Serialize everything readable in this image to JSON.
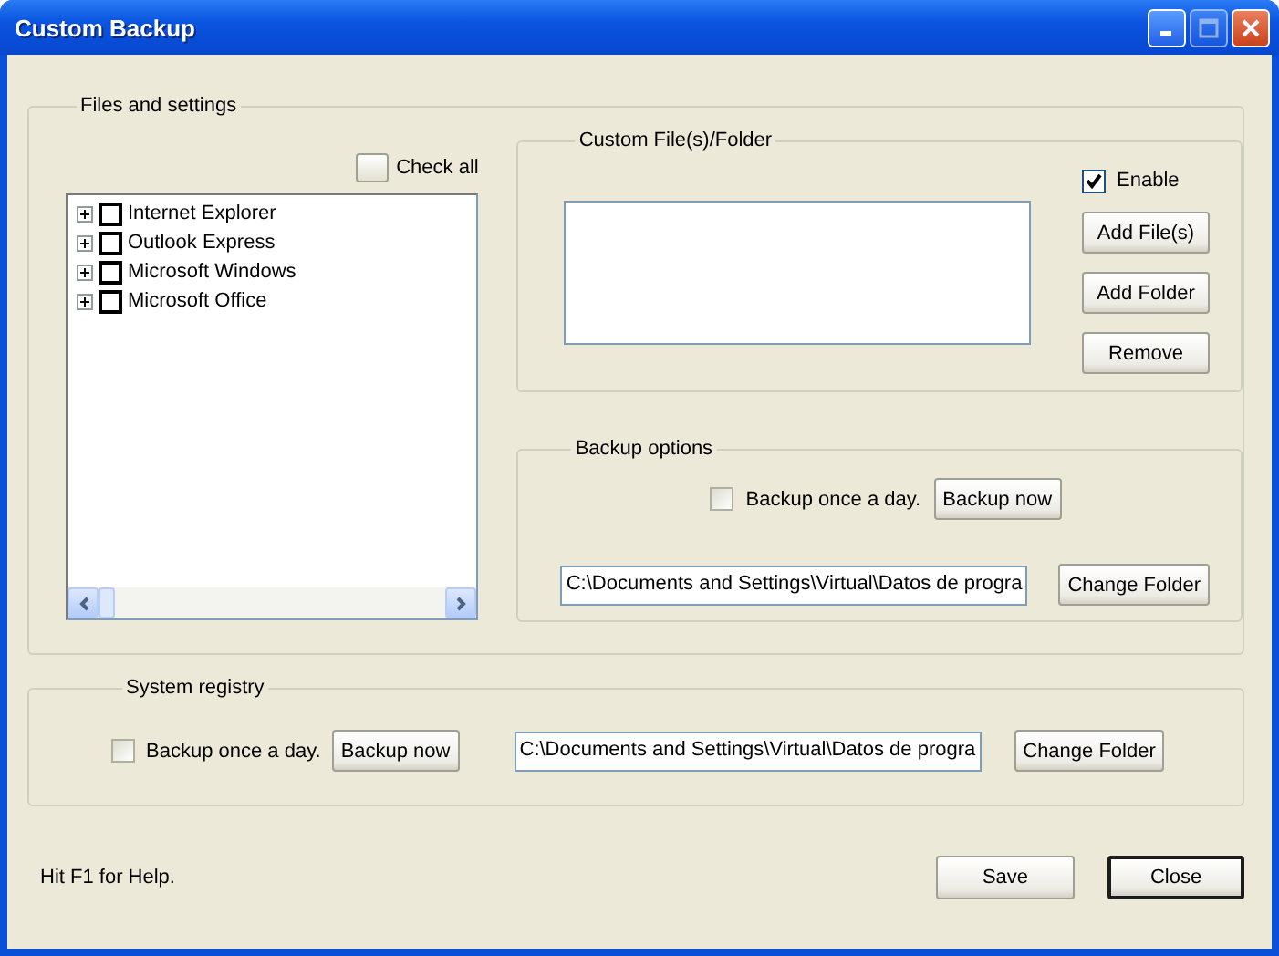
{
  "window": {
    "title": "Custom Backup"
  },
  "files_group": {
    "legend": "Files and settings",
    "check_all": {
      "label": "Check all",
      "checked": false
    },
    "tree": [
      {
        "label": "Internet Explorer",
        "checked": false,
        "expanded": false
      },
      {
        "label": "Outlook Express",
        "checked": false,
        "expanded": false
      },
      {
        "label": "Microsoft Windows",
        "checked": false,
        "expanded": false
      },
      {
        "label": "Microsoft Office",
        "checked": false,
        "expanded": false
      }
    ]
  },
  "custom_group": {
    "legend": "Custom File(s)/Folder",
    "enable": {
      "label": "Enable",
      "checked": true
    },
    "buttons": [
      "Add File(s)",
      "Add Folder",
      "Remove"
    ]
  },
  "backup_options": {
    "legend": "Backup options",
    "daily": {
      "label": "Backup once a day.",
      "checked": false
    },
    "backup_button": "Backup now",
    "path": "C:\\Documents and Settings\\Virtual\\Datos de progra",
    "change_button": "Change Folder"
  },
  "system_registry": {
    "legend": "System registry",
    "daily": {
      "label": "Backup once a day.",
      "checked": false
    },
    "backup_button": "Backup now",
    "path": "C:\\Documents and Settings\\Virtual\\Datos de progra",
    "change_button": "Change Folder"
  },
  "help_text": "Hit F1 for Help.",
  "buttons": [
    {
      "label": "Save",
      "default": false
    },
    {
      "label": "Close",
      "default": true
    }
  ]
}
